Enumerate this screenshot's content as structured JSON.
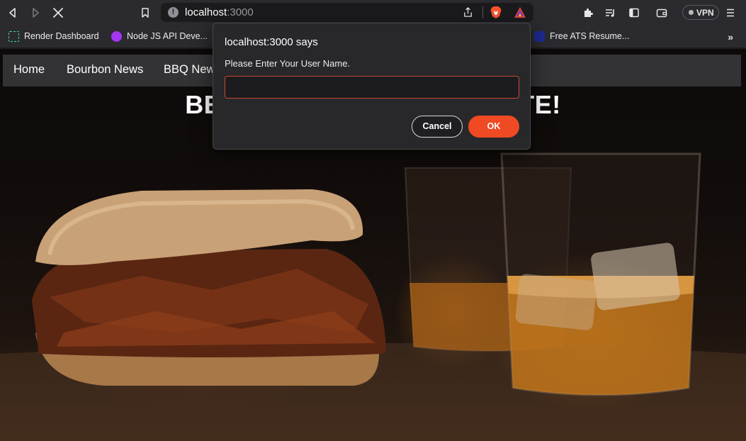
{
  "browser": {
    "url_host": "localhost",
    "url_port": ":3000",
    "vpn_label": "VPN",
    "bookmarks": [
      {
        "label": "Render Dashboard",
        "icon": "render-icon"
      },
      {
        "label": "Node JS API Deve...",
        "icon": "udemy-icon"
      },
      {
        "label": "Free ATS Resume...",
        "icon": "resume-icon"
      }
    ],
    "more_bookmarks": "»"
  },
  "nav": {
    "items": [
      "Home",
      "Bourbon News",
      "BBQ News"
    ]
  },
  "hero": {
    "title_left": "BE",
    "title_right": "TE!"
  },
  "dialog": {
    "title": "localhost:3000 says",
    "message": "Please Enter Your User Name.",
    "input_value": "",
    "cancel_label": "Cancel",
    "ok_label": "OK"
  },
  "colors": {
    "accent": "#f04a24",
    "input_border": "#c4482f"
  }
}
